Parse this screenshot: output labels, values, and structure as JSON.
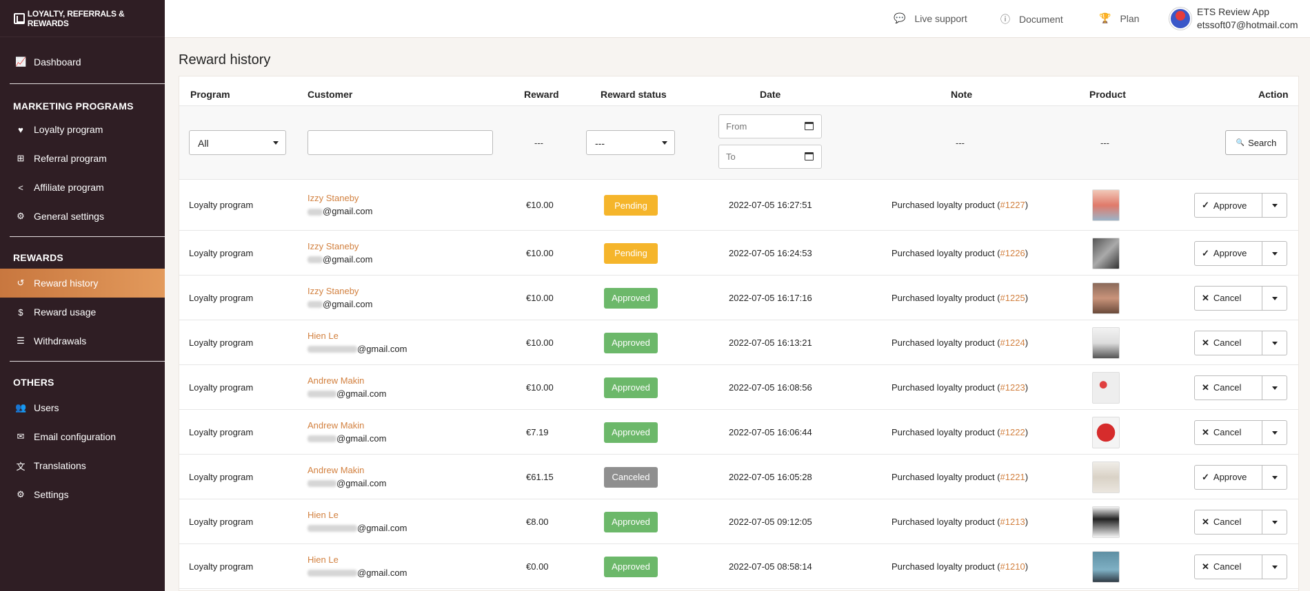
{
  "app": {
    "logo_text": "LOYALTY, REFERRALS & REWARDS"
  },
  "sidebar": {
    "dashboard": {
      "icon": "chart-line-icon",
      "label": "Dashboard"
    },
    "marketing_title": "MARKETING PROGRAMS",
    "marketing": [
      {
        "icon": "heart-icon",
        "label": "Loyalty program"
      },
      {
        "icon": "sitemap-icon",
        "label": "Referral program"
      },
      {
        "icon": "share-icon",
        "label": "Affiliate program"
      },
      {
        "icon": "gears-icon",
        "label": "General settings"
      }
    ],
    "rewards_title": "REWARDS",
    "rewards": [
      {
        "icon": "history-icon",
        "label": "Reward history",
        "active": true
      },
      {
        "icon": "dollar-icon",
        "label": "Reward usage"
      },
      {
        "icon": "list-icon",
        "label": "Withdrawals"
      }
    ],
    "others_title": "OTHERS",
    "others": [
      {
        "icon": "users-icon",
        "label": "Users"
      },
      {
        "icon": "envelope-icon",
        "label": "Email configuration"
      },
      {
        "icon": "language-icon",
        "label": "Translations"
      },
      {
        "icon": "cog-icon",
        "label": "Settings"
      }
    ]
  },
  "header": {
    "live_support": "Live support",
    "document": "Document",
    "plan": "Plan",
    "user_name": "ETS Review App",
    "user_email": "etssoft07@hotmail.com"
  },
  "page": {
    "title": "Reward history"
  },
  "table": {
    "columns": {
      "program": "Program",
      "customer": "Customer",
      "reward": "Reward",
      "status": "Reward status",
      "date": "Date",
      "note": "Note",
      "product": "Product",
      "action": "Action"
    },
    "filters": {
      "program_value": "All",
      "customer_placeholder": "",
      "reward_placeholder": "---",
      "status_value": "---",
      "date_from_placeholder": "From",
      "date_to_placeholder": "To",
      "note_placeholder": "---",
      "product_placeholder": "---",
      "search_label": "Search"
    },
    "rows": [
      {
        "program": "Loyalty program",
        "customer": "Izzy Staneby",
        "email_suffix": "@gmail.com",
        "reward": "€10.00",
        "status": "Pending",
        "date": "2022-07-05 16:27:51",
        "note": "Purchased loyalty product (",
        "order": "#1227",
        "note_end": ")",
        "action": "Approve"
      },
      {
        "program": "Loyalty program",
        "customer": "Izzy Staneby",
        "email_suffix": "@gmail.com",
        "reward": "€10.00",
        "status": "Pending",
        "date": "2022-07-05 16:24:53",
        "note": "Purchased loyalty product (",
        "order": "#1226",
        "note_end": ")",
        "action": "Approve"
      },
      {
        "program": "Loyalty program",
        "customer": "Izzy Staneby",
        "email_suffix": "@gmail.com",
        "reward": "€10.00",
        "status": "Approved",
        "date": "2022-07-05 16:17:16",
        "note": "Purchased loyalty product (",
        "order": "#1225",
        "note_end": ")",
        "action": "Cancel"
      },
      {
        "program": "Loyalty program",
        "customer": "Hien Le",
        "email_suffix": "@gmail.com",
        "reward": "€10.00",
        "status": "Approved",
        "date": "2022-07-05 16:13:21",
        "note": "Purchased loyalty product (",
        "order": "#1224",
        "note_end": ")",
        "action": "Cancel"
      },
      {
        "program": "Loyalty program",
        "customer": "Andrew Makin",
        "email_suffix": "@gmail.com",
        "reward": "€10.00",
        "status": "Approved",
        "date": "2022-07-05 16:08:56",
        "note": "Purchased loyalty product (",
        "order": "#1223",
        "note_end": ")",
        "action": "Cancel"
      },
      {
        "program": "Loyalty program",
        "customer": "Andrew Makin",
        "email_suffix": "@gmail.com",
        "reward": "€7.19",
        "status": "Approved",
        "date": "2022-07-05 16:06:44",
        "note": "Purchased loyalty product (",
        "order": "#1222",
        "note_end": ")",
        "action": "Cancel"
      },
      {
        "program": "Loyalty program",
        "customer": "Andrew Makin",
        "email_suffix": "@gmail.com",
        "reward": "€61.15",
        "status": "Canceled",
        "date": "2022-07-05 16:05:28",
        "note": "Purchased loyalty product (",
        "order": "#1221",
        "note_end": ")",
        "action": "Approve"
      },
      {
        "program": "Loyalty program",
        "customer": "Hien Le",
        "email_suffix": "@gmail.com",
        "reward": "€8.00",
        "status": "Approved",
        "date": "2022-07-05 09:12:05",
        "note": "Purchased loyalty product (",
        "order": "#1213",
        "note_end": ")",
        "action": "Cancel"
      },
      {
        "program": "Loyalty program",
        "customer": "Hien Le",
        "email_suffix": "@gmail.com",
        "reward": "€0.00",
        "status": "Approved",
        "date": "2022-07-05 08:58:14",
        "note": "Purchased loyalty product (",
        "order": "#1210",
        "note_end": ")",
        "action": "Cancel"
      }
    ]
  },
  "colors": {
    "sidebar_bg": "#2f1e24",
    "accent": "#d2803f",
    "pending": "#f5b52b",
    "approved": "#6cb86a",
    "canceled": "#8f8f8f"
  }
}
